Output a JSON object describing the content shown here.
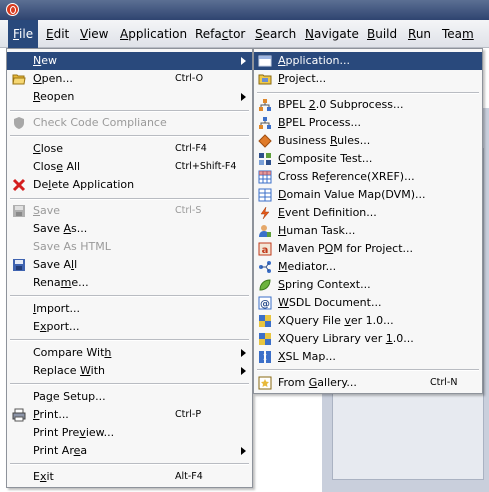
{
  "menubar": {
    "items": [
      {
        "pre": "",
        "key": "F",
        "post": "ile"
      },
      {
        "pre": "",
        "key": "E",
        "post": "dit"
      },
      {
        "pre": "",
        "key": "V",
        "post": "iew"
      },
      {
        "pre": "",
        "key": "A",
        "post": "pplication"
      },
      {
        "pre": "Refa",
        "key": "c",
        "post": "tor"
      },
      {
        "pre": "",
        "key": "S",
        "post": "earch"
      },
      {
        "pre": "",
        "key": "N",
        "post": "avigate"
      },
      {
        "pre": "",
        "key": "B",
        "post": "uild"
      },
      {
        "pre": "",
        "key": "R",
        "post": "un"
      },
      {
        "pre": "Tea",
        "key": "m",
        "post": ""
      }
    ]
  },
  "file_menu": {
    "new": {
      "pre": "",
      "key": "N",
      "post": "ew"
    },
    "open": {
      "pre": "",
      "key": "O",
      "post": "pen...",
      "shortcut": "Ctrl-O"
    },
    "reopen": {
      "pre": "",
      "key": "R",
      "post": "eopen"
    },
    "check_code": {
      "label": "Check Code Compliance"
    },
    "close": {
      "pre": "",
      "key": "C",
      "post": "lose",
      "shortcut": "Ctrl-F4"
    },
    "close_all": {
      "pre": "Clos",
      "key": "e",
      "post": " All",
      "shortcut": "Ctrl+Shift-F4"
    },
    "delete_app": {
      "pre": "De",
      "key": "l",
      "post": "ete Application"
    },
    "save": {
      "pre": "",
      "key": "S",
      "post": "ave",
      "shortcut": "Ctrl-S"
    },
    "save_as": {
      "pre": "Save ",
      "key": "A",
      "post": "s..."
    },
    "save_as_html": {
      "label": "Save As HTML"
    },
    "save_all": {
      "pre": "Save A",
      "key": "l",
      "post": "l"
    },
    "rename": {
      "pre": "Rena",
      "key": "m",
      "post": "e..."
    },
    "import": {
      "pre": "",
      "key": "I",
      "post": "mport..."
    },
    "export": {
      "pre": "E",
      "key": "x",
      "post": "port..."
    },
    "compare_with": {
      "pre": "Compare Wit",
      "key": "h",
      "post": ""
    },
    "replace_with": {
      "pre": "Replace ",
      "key": "W",
      "post": "ith"
    },
    "page_setup": {
      "pre": "Pa",
      "key": "g",
      "post": "e Setup..."
    },
    "print": {
      "pre": "",
      "key": "P",
      "post": "rint...",
      "shortcut": "Ctrl-P"
    },
    "print_preview": {
      "pre": "Print Pre",
      "key": "v",
      "post": "iew..."
    },
    "print_area": {
      "pre": "Print Ar",
      "key": "e",
      "post": "a"
    },
    "exit": {
      "pre": "E",
      "key": "x",
      "post": "it",
      "shortcut": "Alt-F4"
    }
  },
  "new_menu": {
    "application": {
      "pre": "",
      "key": "A",
      "post": "pplication..."
    },
    "project": {
      "pre": "",
      "key": "P",
      "post": "roject..."
    },
    "bpel_sub": {
      "pre": "BPEL ",
      "key": "2",
      "post": ".0 Subprocess..."
    },
    "bpel_process": {
      "pre": "",
      "key": "B",
      "post": "PEL Process..."
    },
    "business_rules": {
      "pre": "Business ",
      "key": "R",
      "post": "ules..."
    },
    "composite_test": {
      "pre": "",
      "key": "C",
      "post": "omposite Test..."
    },
    "cross_reference": {
      "pre": "Cross Re",
      "key": "f",
      "post": "erence(XREF)..."
    },
    "dvm": {
      "pre": "",
      "key": "D",
      "post": "omain Value Map(DVM)..."
    },
    "event_def": {
      "pre": "",
      "key": "E",
      "post": "vent Definition..."
    },
    "human_task": {
      "pre": "",
      "key": "H",
      "post": "uman Task..."
    },
    "maven": {
      "pre": "Maven P",
      "key": "O",
      "post": "M for Project..."
    },
    "mediator": {
      "pre": "",
      "key": "M",
      "post": "ediator..."
    },
    "spring": {
      "pre": "",
      "key": "S",
      "post": "pring Context..."
    },
    "wsdl": {
      "pre": "",
      "key": "W",
      "post": "SDL Document..."
    },
    "xquery_file": {
      "pre": "XQuery File ",
      "key": "v",
      "post": "er 1.0..."
    },
    "xquery_lib": {
      "pre": "XQuery Library ver ",
      "key": "1",
      "post": ".0..."
    },
    "xsl_map": {
      "pre": "",
      "key": "X",
      "post": "SL Map..."
    },
    "from_gallery": {
      "pre": "From ",
      "key": "G",
      "post": "allery...",
      "shortcut": "Ctrl-N"
    }
  }
}
